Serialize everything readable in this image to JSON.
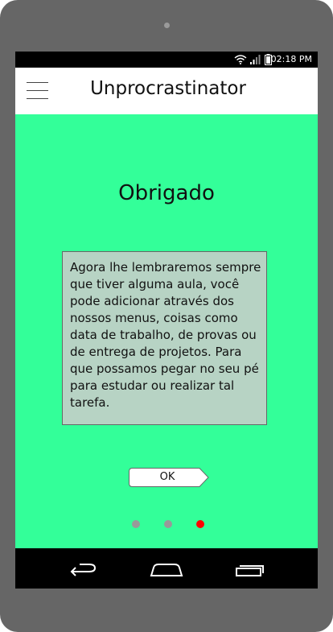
{
  "status_bar": {
    "time": "02:18 PM",
    "icons": [
      "wifi-icon",
      "signal-icon",
      "battery-icon"
    ]
  },
  "app_bar": {
    "menu_icon": "hamburger-menu-icon",
    "title": "Unprocrastinator"
  },
  "page": {
    "heading": "Obrigado",
    "message": "Agora lhe lembraremos sempre que tiver alguma aula, você pode adicionar através dos nossos menus, coisas como data de trabalho, de provas ou de entrega de projetos. Para que possamos pegar no seu pé para estudar ou realizar tal tarefa.",
    "ok_label": "OK"
  },
  "pagination": {
    "total": 3,
    "current": 3,
    "active_color": "#ff0000",
    "inactive_color": "#999999"
  },
  "nav_bar": {
    "icons": [
      "back-icon",
      "home-icon",
      "recent-apps-icon"
    ]
  },
  "colors": {
    "content_background": "#33ff99",
    "message_background": "#b7d3c4",
    "device_frame": "#666666"
  }
}
